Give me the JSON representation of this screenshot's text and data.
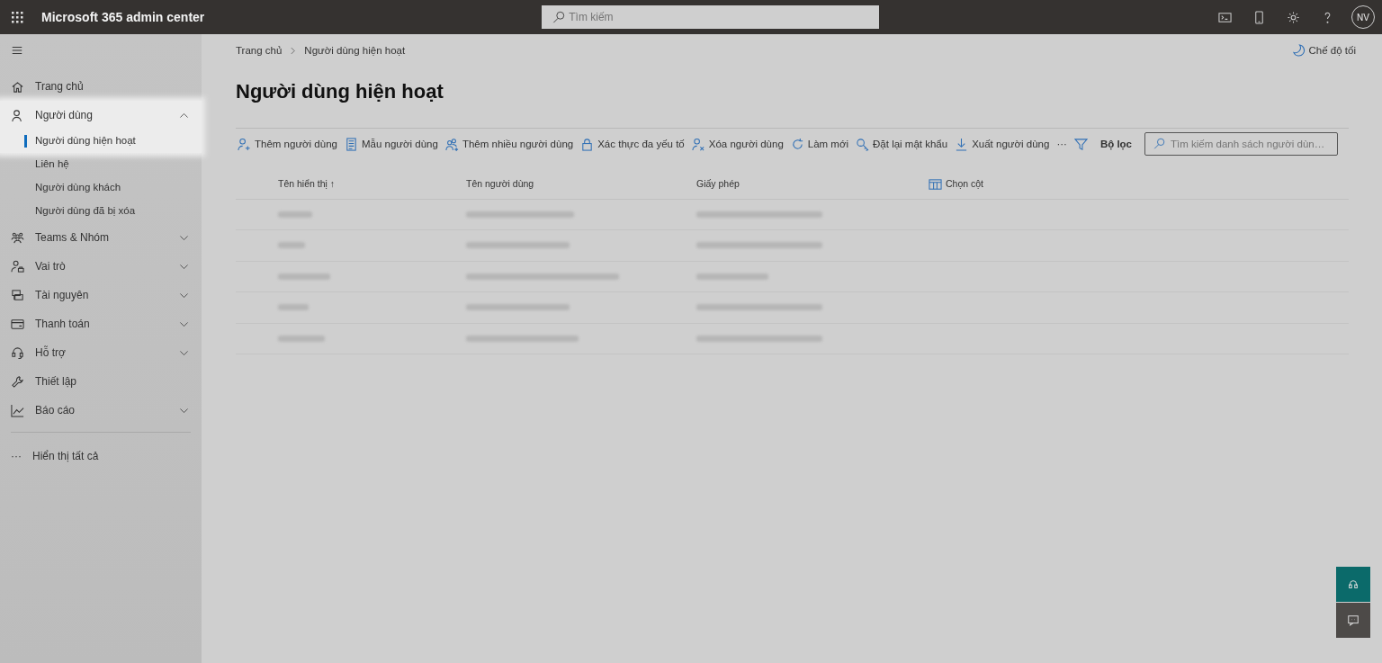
{
  "app": {
    "title": "Microsoft 365 admin center",
    "avatar": "NV"
  },
  "search": {
    "placeholder": "Tìm kiếm"
  },
  "sidebar": {
    "items": [
      {
        "label": "Trang chủ",
        "kind": "home"
      },
      {
        "label": "Người dùng",
        "kind": "user",
        "expanded": true,
        "spotlight": true,
        "children": [
          {
            "label": "Người dùng hiện hoạt",
            "selected": true
          },
          {
            "label": "Liên hệ",
            "selected": false
          },
          {
            "label": "Người dùng khách",
            "selected": false
          },
          {
            "label": "Người dùng đã bị xóa",
            "selected": false
          }
        ]
      },
      {
        "label": "Teams & Nhóm",
        "kind": "teams",
        "expanded": false
      },
      {
        "label": "Vai trò",
        "kind": "role",
        "expanded": false
      },
      {
        "label": "Tài nguyên",
        "kind": "resource",
        "expanded": false
      },
      {
        "label": "Thanh toán",
        "kind": "billing",
        "expanded": false
      },
      {
        "label": "Hỗ trợ",
        "kind": "support",
        "expanded": false
      },
      {
        "label": "Thiết lập",
        "kind": "setup"
      },
      {
        "label": "Báo cáo",
        "kind": "report",
        "expanded": false
      }
    ],
    "show_all": {
      "icon": "···",
      "label": "Hiển thị tất cả"
    }
  },
  "breadcrumb": [
    "Trang chủ",
    "Người dùng hiện hoạt"
  ],
  "dark_mode": "Chế độ tối",
  "page_title": "Người dùng hiện hoạt",
  "toolbar": [
    {
      "label": "Thêm người dùng",
      "kind": "add-user"
    },
    {
      "label": "Mẫu người dùng",
      "kind": "template"
    },
    {
      "label": "Thêm nhiều người dùng",
      "kind": "add-users"
    },
    {
      "label": "Xác thực đa yếu tố",
      "kind": "lock"
    },
    {
      "label": "Xóa người dùng",
      "kind": "delete-user"
    },
    {
      "label": "Làm mới",
      "kind": "refresh"
    },
    {
      "label": "Đặt lại mật khẩu",
      "kind": "key"
    },
    {
      "label": "Xuất người dùng",
      "kind": "export"
    }
  ],
  "more": "···",
  "filter": {
    "label": "Bộ lọc"
  },
  "list_search": {
    "placeholder": "Tìm kiếm danh sách người dùn…"
  },
  "table": {
    "columns": [
      {
        "label": "Tên hiển thị",
        "sort": "↑"
      },
      {
        "label": "Tên người dùng"
      },
      {
        "label": "Giấy phép"
      }
    ],
    "choose_columns": "Chọn cột",
    "rows": [
      {
        "blurred": true
      },
      {
        "blurred": true
      },
      {
        "blurred": true
      },
      {
        "blurred": true
      },
      {
        "blurred": true
      }
    ]
  }
}
